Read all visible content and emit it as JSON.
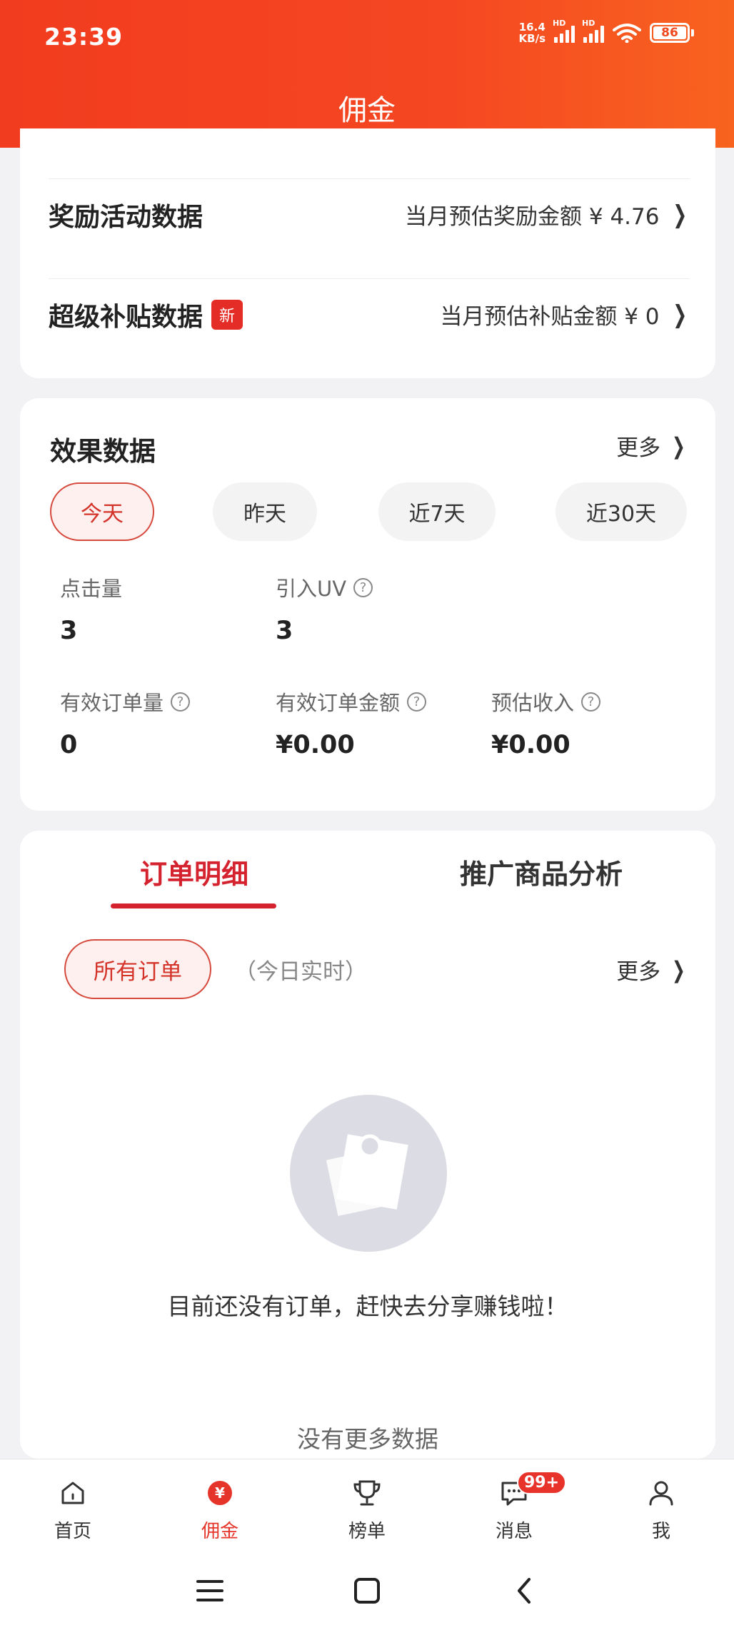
{
  "status_bar": {
    "time": "23:39",
    "net_speed": "16.4",
    "net_unit": "KB/s",
    "sim1": "HD",
    "sim2": "HD",
    "battery": "86"
  },
  "header": {
    "title": "佣金"
  },
  "rewards": {
    "activity_label": "奖励活动数据",
    "activity_value": "当月预估奖励金额 ¥ 4.76",
    "subsidy_label": "超级补贴数据",
    "subsidy_badge": "新",
    "subsidy_value": "当月预估补贴金额 ¥ 0"
  },
  "effect": {
    "title": "效果数据",
    "more": "更多",
    "periods": [
      "今天",
      "昨天",
      "近7天",
      "近30天"
    ],
    "active_period": "今天",
    "metrics": [
      {
        "label": "点击量",
        "value": "3"
      },
      {
        "label": "引入UV",
        "value": "3"
      },
      {
        "label": "有效订单量",
        "value": "0"
      },
      {
        "label": "有效订单金额",
        "value": "¥0.00"
      },
      {
        "label": "预估收入",
        "value": "¥0.00"
      }
    ]
  },
  "orders": {
    "tabs": [
      "订单明细",
      "推广商品分析"
    ],
    "active_tab": "订单明细",
    "filter": "所有订单",
    "realtime": "（今日实时）",
    "more": "更多",
    "empty_text": "目前还没有订单，赶快去分享赚钱啦！",
    "no_more": "没有更多数据"
  },
  "tabbar": {
    "items": [
      {
        "label": "首页",
        "icon": "home-icon"
      },
      {
        "label": "佣金",
        "icon": "yuan-icon"
      },
      {
        "label": "榜单",
        "icon": "trophy-icon"
      },
      {
        "label": "消息",
        "icon": "message-icon"
      },
      {
        "label": "我",
        "icon": "user-icon"
      }
    ],
    "active": "佣金",
    "message_badge": "99+"
  },
  "colors": {
    "accent": "#d4232f",
    "header": "#f23c1f"
  }
}
